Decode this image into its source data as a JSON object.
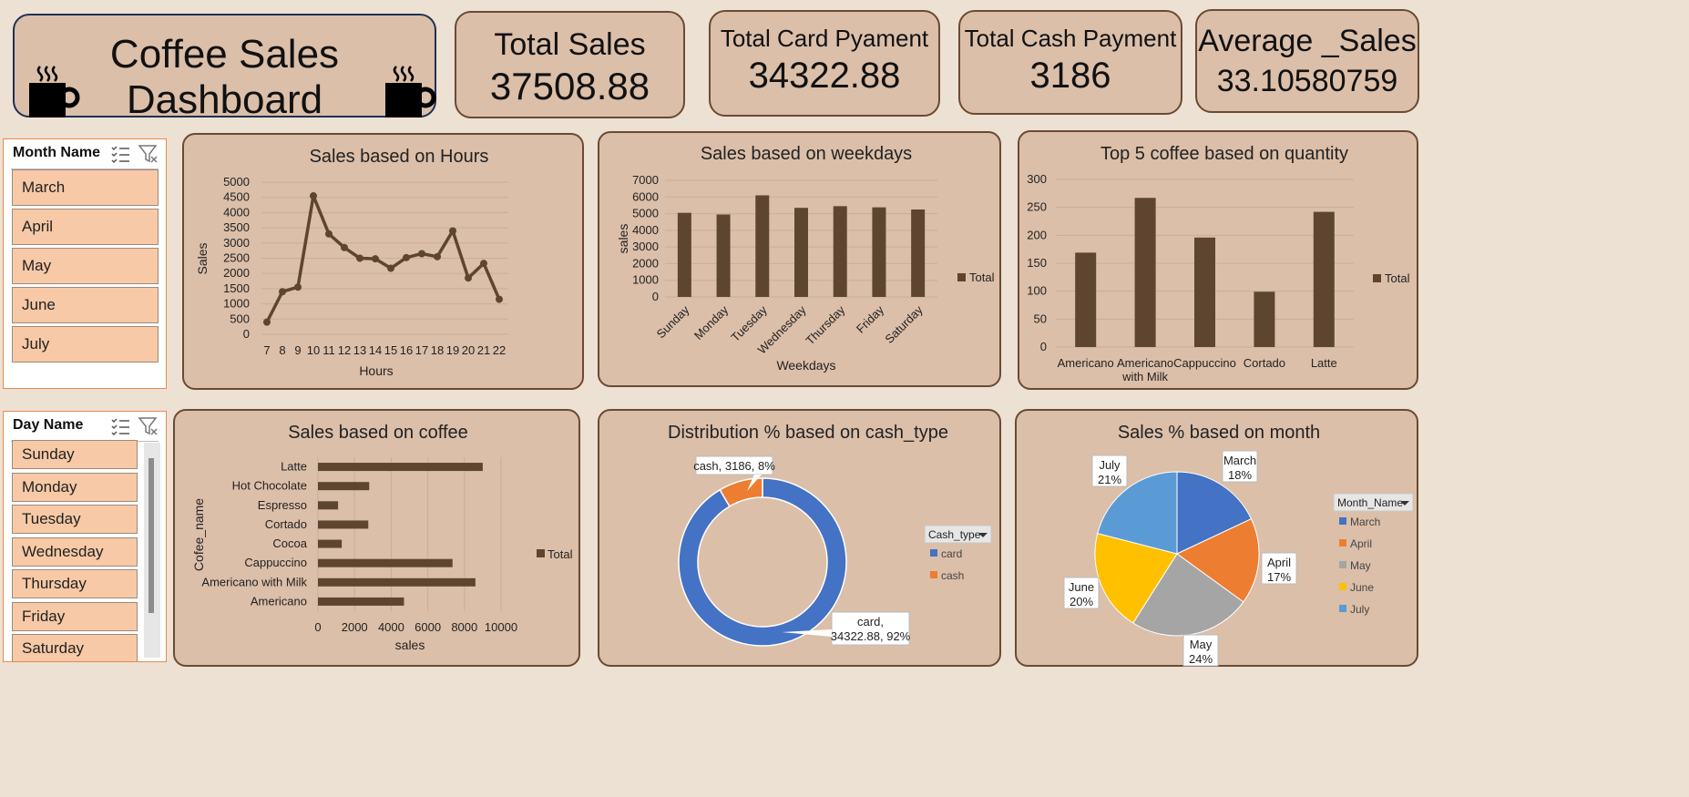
{
  "title": "Coffee Sales Dashboard",
  "kpis": {
    "total_sales": {
      "label": "Total Sales",
      "value": "37508.88"
    },
    "card": {
      "label": "Total Card Pyament",
      "value": "34322.88"
    },
    "cash": {
      "label": "Total Cash Payment",
      "value": "3186"
    },
    "avg": {
      "label": "Average _Sales",
      "value": "33.10580759"
    }
  },
  "slicers": {
    "month": {
      "header": "Month Name",
      "items": [
        "March",
        "April",
        "May",
        "June",
        "July"
      ]
    },
    "day": {
      "header": "Day Name",
      "items": [
        "Sunday",
        "Monday",
        "Tuesday",
        "Wednesday",
        "Thursday",
        "Friday",
        "Saturday"
      ]
    }
  },
  "colors": {
    "bar": "#5e4530",
    "line": "#5e4530",
    "grid": "#c9ad97",
    "card": "#4472c4",
    "cash": "#ed7d31",
    "march": "#4472c4",
    "april": "#ed7d31",
    "may": "#a5a5a5",
    "june": "#ffc000",
    "july": "#5b9bd5"
  },
  "chart_data": [
    {
      "id": "hours",
      "type": "line",
      "title": "Sales  based on Hours",
      "xlabel": "Hours",
      "ylabel": "Sales",
      "x": [
        "7",
        "8",
        "9",
        "10",
        "11",
        "12",
        "13",
        "14",
        "15",
        "16",
        "17",
        "18",
        "19",
        "20",
        "21",
        "22"
      ],
      "values": [
        400,
        1400,
        1550,
        4550,
        3300,
        2850,
        2500,
        2480,
        2170,
        2520,
        2650,
        2550,
        3400,
        1850,
        2330,
        1150
      ],
      "ylim": [
        0,
        5000
      ],
      "yticks": [
        0,
        500,
        1000,
        1500,
        2000,
        2500,
        3000,
        3500,
        4000,
        4500,
        5000
      ],
      "legend": "none"
    },
    {
      "id": "weekdays",
      "type": "bar",
      "title": "Sales based on weekdays",
      "xlabel": "Weekdays",
      "ylabel": "sales",
      "categories": [
        "Sunday",
        "Monday",
        "Tuesday",
        "Wednesday",
        "Thursday",
        "Friday",
        "Saturday"
      ],
      "series": [
        {
          "name": "Total",
          "values": [
            5050,
            4950,
            6100,
            5350,
            5450,
            5380,
            5250
          ]
        }
      ],
      "ylim": [
        0,
        7000
      ],
      "yticks": [
        0,
        1000,
        2000,
        3000,
        4000,
        5000,
        6000,
        7000
      ],
      "legend": "right"
    },
    {
      "id": "top5",
      "type": "bar",
      "title": "Top 5 coffee based on quantity",
      "categories": [
        "Americano",
        "Americano with Milk",
        "Cappuccino",
        "Cortado",
        "Latte"
      ],
      "series": [
        {
          "name": "Total",
          "values": [
            169,
            267,
            196,
            99,
            242
          ]
        }
      ],
      "ylim": [
        0,
        300
      ],
      "yticks": [
        0,
        50,
        100,
        150,
        200,
        250,
        300
      ],
      "legend": "right"
    },
    {
      "id": "coffee",
      "type": "bar",
      "orientation": "horizontal",
      "title": "Sales based on coffee",
      "xlabel": "sales",
      "ylabel": "Cofee_name",
      "categories": [
        "Latte",
        "Hot Chocolate",
        "Espresso",
        "Cortado",
        "Cocoa",
        "Cappuccino",
        "Americano with Milk",
        "Americano"
      ],
      "series": [
        {
          "name": "Total",
          "values": [
            9000,
            2800,
            1100,
            2750,
            1300,
            7350,
            8600,
            4700
          ]
        }
      ],
      "xlim": [
        0,
        10000
      ],
      "xticks": [
        0,
        2000,
        4000,
        6000,
        8000,
        10000
      ],
      "legend": "right"
    },
    {
      "id": "cashtype",
      "type": "pie",
      "variant": "donut",
      "title": "Distribution % based on cash_type",
      "legend_title": "Cash_type",
      "slices": [
        {
          "name": "card",
          "value": 34322.88,
          "label": "card,",
          "label2": "34322.88, 92%"
        },
        {
          "name": "cash",
          "value": 3186,
          "label": "cash, 3186, 8%"
        }
      ]
    },
    {
      "id": "months",
      "type": "pie",
      "title": "Sales % based on month",
      "legend_title": "Month_Name",
      "slices": [
        {
          "name": "March",
          "percent": 18,
          "label": "March",
          "label2": "18%"
        },
        {
          "name": "April",
          "percent": 17,
          "label": "April",
          "label2": "17%"
        },
        {
          "name": "May",
          "percent": 24,
          "label": "May",
          "label2": "24%"
        },
        {
          "name": "June",
          "percent": 20,
          "label": "June",
          "label2": "20%"
        },
        {
          "name": "July",
          "percent": 21,
          "label": "July",
          "label2": "21%"
        }
      ]
    }
  ]
}
